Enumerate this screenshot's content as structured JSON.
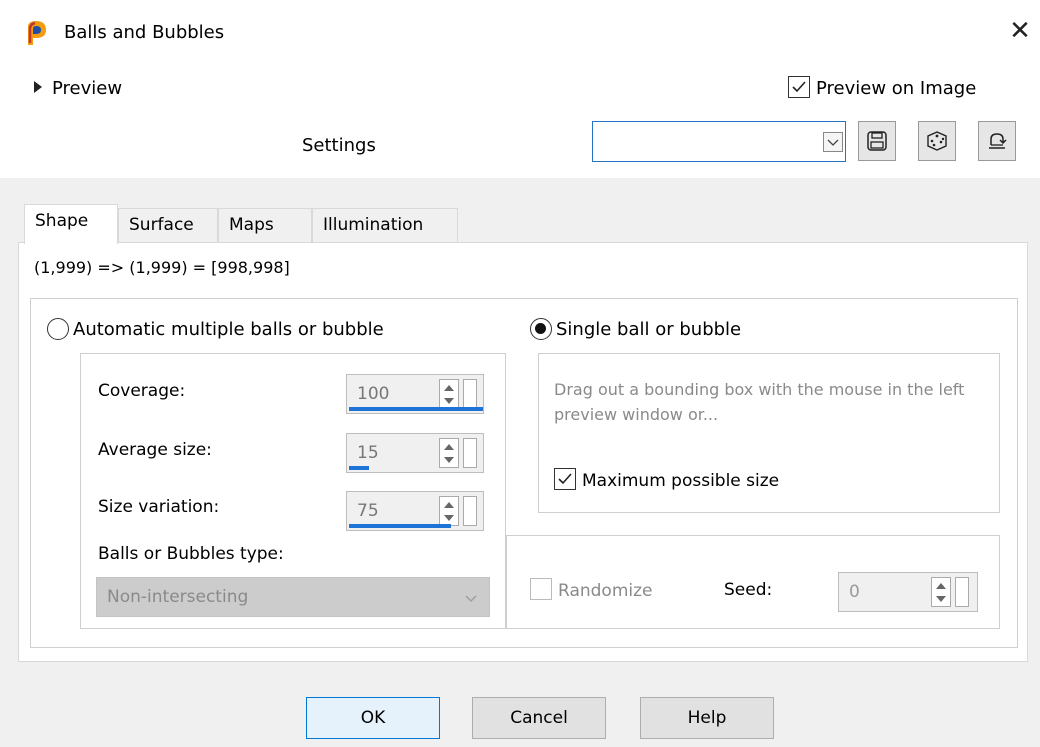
{
  "window": {
    "title": "Balls and Bubbles",
    "close_glyph": "✕"
  },
  "preview": {
    "label": "Preview",
    "on_image_label": "Preview on Image",
    "on_image_checked": true
  },
  "settings": {
    "label": "Settings",
    "value": ""
  },
  "tabs": [
    {
      "label": "Shape",
      "active": true
    },
    {
      "label": "Surface",
      "active": false
    },
    {
      "label": "Maps",
      "active": false
    },
    {
      "label": "Illumination",
      "active": false
    }
  ],
  "shape": {
    "coords": "(1,999) => (1,999) = [998,998]",
    "auto_label": "Automatic multiple balls or bubble",
    "auto_selected": false,
    "single_label": "Single ball or bubble",
    "single_selected": true,
    "coverage": {
      "label": "Coverage:",
      "value": "100",
      "fill": 1.0
    },
    "average_size": {
      "label": "Average size:",
      "value": "15",
      "fill": 0.15
    },
    "size_variation": {
      "label": "Size variation:",
      "value": "75",
      "fill": 0.75
    },
    "type_label": "Balls or Bubbles type:",
    "type_value": "Non-intersecting",
    "hint": "Drag out a bounding box with the mouse in the left preview window or...",
    "max_size_label": "Maximum possible size",
    "max_size_checked": true,
    "randomize_label": "Randomize",
    "seed_label": "Seed:",
    "seed_value": "0"
  },
  "buttons": {
    "ok": "OK",
    "cancel": "Cancel",
    "help": "Help"
  },
  "colors": {
    "accent": "#1e74d6",
    "focus_border": "#0078d7"
  }
}
